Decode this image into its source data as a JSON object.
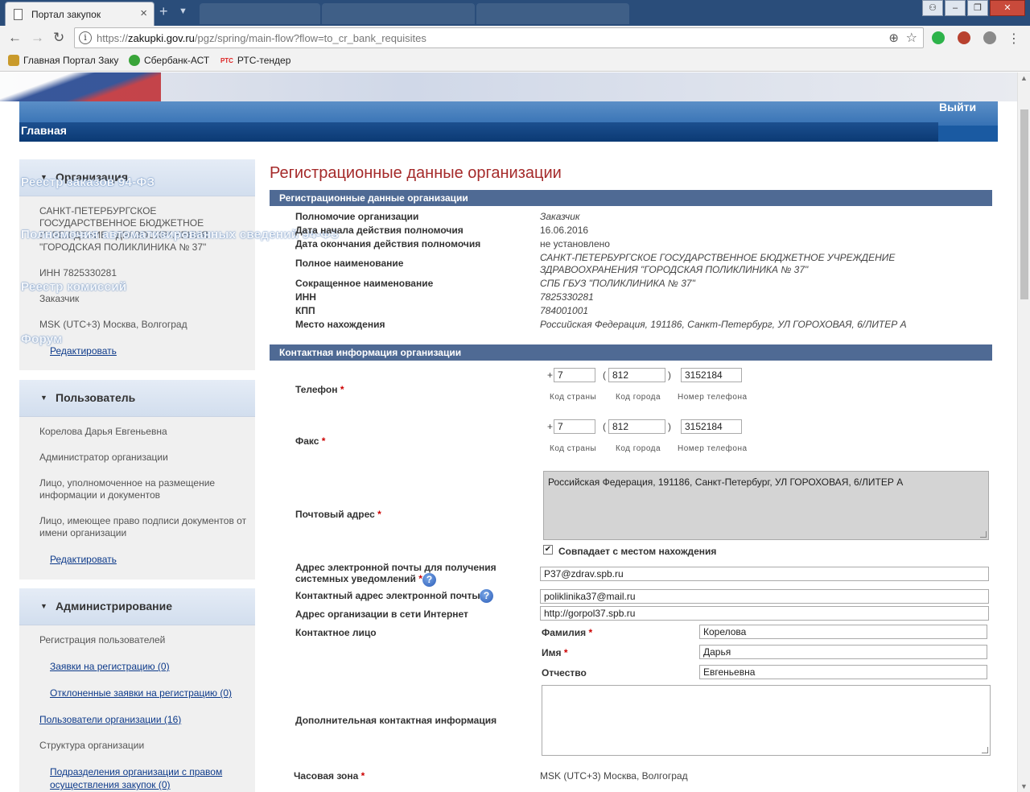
{
  "browser": {
    "tab_title": "Портал закупок",
    "url_scheme": "https://",
    "url_host": "zakupki.gov.ru",
    "url_path": "/pgz/spring/main-flow?flow=to_cr_bank_requisites",
    "bookmarks": [
      "Главная Портал Заку",
      "Сбербанк-АСТ",
      "РТС-тендер"
    ],
    "bookmark_rts_icon_text": "РТС"
  },
  "header": {
    "home_label": "Главная",
    "logout_label": "Выйти"
  },
  "overlay_menu": [
    "Реестр заказов 94-ФЗ",
    "Полномочия автоматизированных сведений 94-ФЗ",
    "Реестр комиссий",
    "Форум"
  ],
  "sidebar": {
    "organization": {
      "title": "Организация",
      "name": "САНКТ-ПЕТЕРБУРГСКОЕ ГОСУДАРСТВЕННОЕ БЮДЖЕТНОЕ УЧРЕЖДЕНИЕ ЗДРАВООХРАНЕНИЯ \"ГОРОДСКАЯ ПОЛИКЛИНИКА № 37\"",
      "inn": "ИНН 7825330281",
      "role": "Заказчик",
      "timezone": "MSK (UTC+3) Москва, Волгоград",
      "edit_label": "Редактировать"
    },
    "user": {
      "title": "Пользователь",
      "name": "Корелова Дарья Евгеньевна",
      "role1": "Администратор организации",
      "role2": "Лицо, уполномоченное на размещение информации и документов",
      "role3": "Лицо, имеющее право подписи документов от имени организации",
      "edit_label": "Редактировать"
    },
    "admin": {
      "title": "Администрирование",
      "registration": "Регистрация пользователей",
      "reg_requests": "Заявки на регистрацию (0)",
      "rejected_requests": "Отклоненные заявки на регистрацию (0)",
      "org_users": "Пользователи организации (16)",
      "org_structure": "Структура организации",
      "subdivisions": "Подразделения организации с правом осуществления закупок (0)"
    }
  },
  "main": {
    "title": "Регистрационные данные организации",
    "section_reg": "Регистрационные данные организации",
    "reg_fields": [
      {
        "label": "Полномочие организации",
        "value": "Заказчик"
      },
      {
        "label": "Дата начала действия полномочия",
        "value": "16.06.2016"
      },
      {
        "label": "Дата окончания действия полномочия",
        "value": "не установлено"
      },
      {
        "label": "Полное наименование",
        "value": "САНКТ-ПЕТЕРБУРГСКОЕ ГОСУДАРСТВЕННОЕ БЮДЖЕТНОЕ УЧРЕЖДЕНИЕ ЗДРАВООХРАНЕНИЯ \"ГОРОДСКАЯ ПОЛИКЛИНИКА № 37\""
      },
      {
        "label": "Сокращенное наименование",
        "value": "СПБ ГБУЗ \"ПОЛИКЛИНИКА № 37\""
      },
      {
        "label": "ИНН",
        "value": "7825330281"
      },
      {
        "label": "КПП",
        "value": "784001001"
      },
      {
        "label": "Место нахождения",
        "value": "Российская Федерация, 191186, Санкт-Петербург, УЛ ГОРОХОВАЯ, 6/ЛИТЕР А"
      }
    ],
    "section_contact": "Контактная информация организации",
    "phone": {
      "label": "Телефон",
      "country": "7",
      "city": "812",
      "number": "3152184"
    },
    "fax": {
      "label": "Факс",
      "country": "7",
      "city": "812",
      "number": "3152184"
    },
    "phone_hints": {
      "country": "Код страны",
      "city": "Код города",
      "number": "Номер телефона"
    },
    "postal": {
      "label": "Почтовый адрес",
      "value": "Российская Федерация, 191186, Санкт-Петербург, УЛ ГОРОХОВАЯ, 6/ЛИТЕР А"
    },
    "same_as_location": "Совпадает с местом нахождения",
    "email_notif": {
      "label": "Адрес электронной почты для получения системных уведомлений",
      "value": "P37@zdrav.spb.ru"
    },
    "email_contact": {
      "label": "Контактный адрес электронной почты",
      "value": "poliklinika37@mail.ru"
    },
    "website": {
      "label": "Адрес организации в сети Интернет",
      "value": "http://gorpol37.spb.ru"
    },
    "contact_person": {
      "label": "Контактное лицо",
      "surname_label": "Фамилия",
      "surname": "Корелова",
      "name_label": "Имя",
      "name": "Дарья",
      "patronymic_label": "Отчество",
      "patronymic": "Евгеньевна"
    },
    "extra_info": {
      "label": "Дополнительная контактная информация",
      "value": ""
    },
    "timezone": {
      "label": "Часовая зона",
      "value": "MSK (UTC+3) Москва, Волгоград"
    },
    "plus": "+",
    "paren_open": "(",
    "paren_close": ")",
    "required_mark": "*",
    "help_glyph": "?"
  },
  "colors": {
    "title_red": "#a52a2a",
    "section_bar": "#4f6a94",
    "link_blue": "#0d3a8a",
    "required": "#cc0000"
  }
}
